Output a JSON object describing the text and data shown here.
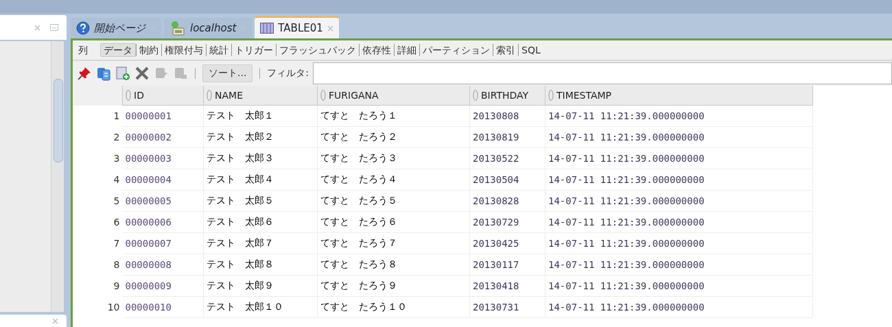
{
  "editor_tabs": [
    {
      "label": "開始ページ",
      "kind": "help",
      "selected": false
    },
    {
      "label": "localhost",
      "kind": "connection",
      "selected": false
    },
    {
      "label": "TABLE01",
      "kind": "table",
      "selected": true
    }
  ],
  "sub_tabs": [
    {
      "label": "列",
      "selected": false
    },
    {
      "label": "データ",
      "selected": true
    },
    {
      "label": "制約",
      "selected": false
    },
    {
      "label": "権限付与",
      "selected": false
    },
    {
      "label": "統計",
      "selected": false
    },
    {
      "label": "トリガー",
      "selected": false
    },
    {
      "label": "フラッシュバック",
      "selected": false
    },
    {
      "label": "依存性",
      "selected": false
    },
    {
      "label": "詳細",
      "selected": false
    },
    {
      "label": "パーティション",
      "selected": false
    },
    {
      "label": "索引",
      "selected": false
    },
    {
      "label": "SQL",
      "selected": false
    }
  ],
  "toolbar": {
    "tools": [
      {
        "kind": "pin",
        "disabled": false
      },
      {
        "kind": "refresh",
        "disabled": false
      },
      {
        "kind": "insert",
        "disabled": false
      },
      {
        "kind": "delete",
        "disabled": false
      },
      {
        "kind": "commit",
        "disabled": true
      },
      {
        "kind": "rollback",
        "disabled": true
      }
    ],
    "sort_button": "ソート...",
    "filter_label": "フィルタ:"
  },
  "table": {
    "columns": [
      "ID",
      "NAME",
      "FURIGANA",
      "BIRTHDAY",
      "TIMESTAMP"
    ],
    "rows": [
      {
        "number": "1",
        "cells": [
          "00000001",
          "テスト　太郎１",
          "てすと　たろう１",
          "20130808",
          "14-07-11 11:21:39.000000000"
        ]
      },
      {
        "number": "2",
        "cells": [
          "00000002",
          "テスト　太郎２",
          "てすと　たろう２",
          "20130819",
          "14-07-11 11:21:39.000000000"
        ]
      },
      {
        "number": "3",
        "cells": [
          "00000003",
          "テスト　太郎３",
          "てすと　たろう３",
          "20130522",
          "14-07-11 11:21:39.000000000"
        ]
      },
      {
        "number": "4",
        "cells": [
          "00000004",
          "テスト　太郎４",
          "てすと　たろう４",
          "20130504",
          "14-07-11 11:21:39.000000000"
        ]
      },
      {
        "number": "5",
        "cells": [
          "00000005",
          "テスト　太郎５",
          "てすと　たろう５",
          "20130828",
          "14-07-11 11:21:39.000000000"
        ]
      },
      {
        "number": "6",
        "cells": [
          "00000006",
          "テスト　太郎６",
          "てすと　たろう６",
          "20130729",
          "14-07-11 11:21:39.000000000"
        ]
      },
      {
        "number": "7",
        "cells": [
          "00000007",
          "テスト　太郎７",
          "てすと　たろう７",
          "20130425",
          "14-07-11 11:21:39.000000000"
        ]
      },
      {
        "number": "8",
        "cells": [
          "00000008",
          "テスト　太郎８",
          "てすと　たろう８",
          "20130117",
          "14-07-11 11:21:39.000000000"
        ]
      },
      {
        "number": "9",
        "cells": [
          "00000009",
          "テスト　太郎９",
          "てすと　たろう９",
          "20130418",
          "14-07-11 11:21:39.000000000"
        ]
      },
      {
        "number": "10",
        "cells": [
          "00000010",
          "テスト　太郎１０",
          "てすと　たろう１０",
          "20130731",
          "14-07-11 11:21:39.000000000"
        ]
      }
    ]
  }
}
